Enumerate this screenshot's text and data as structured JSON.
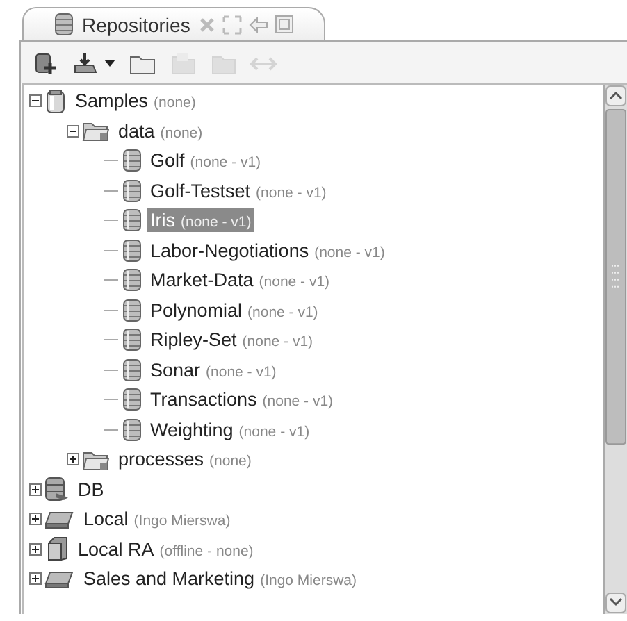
{
  "tab": {
    "title": "Repositories",
    "selected": true
  },
  "toolbar": [
    {
      "kind": "add-repository",
      "disabled": false
    },
    {
      "kind": "import",
      "disabled": false
    },
    {
      "kind": "folder",
      "disabled": false
    },
    {
      "kind": "copy",
      "disabled": true
    },
    {
      "kind": "paste",
      "disabled": true
    },
    {
      "kind": "swap",
      "disabled": true
    }
  ],
  "tree": [
    {
      "name": "Samples",
      "detail": "(none)",
      "kind": "repository",
      "expanded": true,
      "selected": false,
      "children": [
        {
          "name": "data",
          "detail": "(none)",
          "kind": "folder",
          "expanded": true,
          "selected": false,
          "children": [
            {
              "name": "Golf",
              "detail": "(none - v1)",
              "kind": "data",
              "selected": false
            },
            {
              "name": "Golf-Testset",
              "detail": "(none - v1)",
              "kind": "data",
              "selected": false
            },
            {
              "name": "Iris",
              "detail": "(none - v1)",
              "kind": "data",
              "selected": true
            },
            {
              "name": "Labor-Negotiations",
              "detail": "(none - v1)",
              "kind": "data",
              "selected": false
            },
            {
              "name": "Market-Data",
              "detail": "(none - v1)",
              "kind": "data",
              "selected": false
            },
            {
              "name": "Polynomial",
              "detail": "(none - v1)",
              "kind": "data",
              "selected": false
            },
            {
              "name": "Ripley-Set",
              "detail": "(none - v1)",
              "kind": "data",
              "selected": false
            },
            {
              "name": "Sonar",
              "detail": "(none - v1)",
              "kind": "data",
              "selected": false
            },
            {
              "name": "Transactions",
              "detail": "(none - v1)",
              "kind": "data",
              "selected": false
            },
            {
              "name": "Weighting",
              "detail": "(none - v1)",
              "kind": "data",
              "selected": false
            }
          ]
        },
        {
          "name": "processes",
          "detail": "(none)",
          "kind": "folder",
          "expanded": false,
          "selected": false
        }
      ]
    },
    {
      "name": "DB",
      "kind": "db",
      "expanded": false,
      "selected": false
    },
    {
      "name": "Local",
      "detail": "(Ingo Mierswa)",
      "kind": "local",
      "expanded": false,
      "selected": false
    },
    {
      "name": "Local RA",
      "detail": "(offline - none)",
      "kind": "remote",
      "expanded": false,
      "selected": false
    },
    {
      "name": "Sales and Marketing",
      "detail": "(Ingo Mierswa)",
      "kind": "local",
      "expanded": false,
      "selected": false
    }
  ]
}
